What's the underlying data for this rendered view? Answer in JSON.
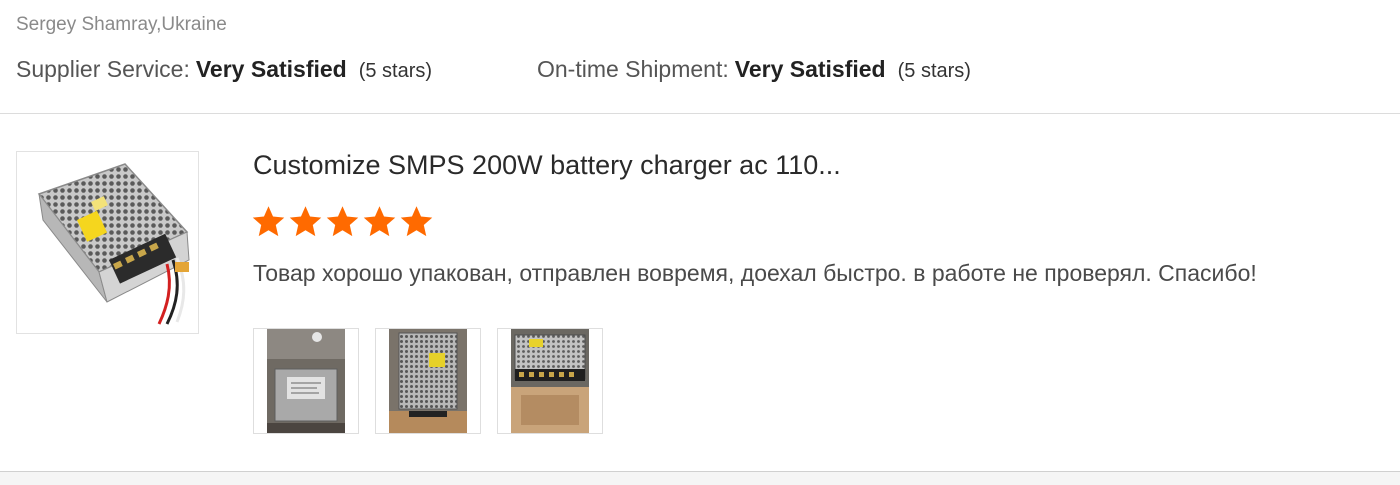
{
  "reviewer": {
    "name_location": "Sergey Shamray,Ukraine"
  },
  "ratings": {
    "supplier_service": {
      "label": "Supplier Service:",
      "value": "Very Satisfied",
      "stars_text": "(5 stars)"
    },
    "shipment": {
      "label": "On-time Shipment:",
      "value": "Very Satisfied",
      "stars_text": "(5 stars)"
    }
  },
  "product": {
    "title": "Customize SMPS 200W battery charger ac 110...",
    "rating": 5,
    "star_color": "#ff6a00",
    "thumbnail_icon": "power-supply-image"
  },
  "review": {
    "text": "Товар хорошо упакован, отправлен вовремя, доехал быстро. в работе не проверял. Спасибо!"
  },
  "photos": [
    {
      "icon": "review-photo-label"
    },
    {
      "icon": "review-photo-unit-top"
    },
    {
      "icon": "review-photo-unit-terminals"
    }
  ]
}
